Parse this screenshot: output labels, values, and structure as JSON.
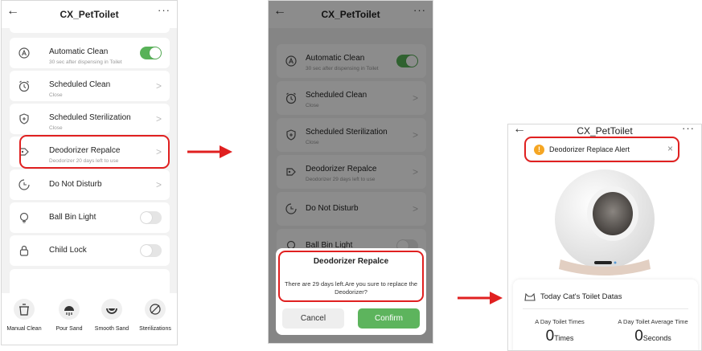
{
  "screen1": {
    "title": "CX_PetToilet",
    "back_glyph": "←",
    "more_glyph": "···",
    "settings": [
      {
        "title": "Automatic Clean",
        "subtitle": "30 sec after dispensing in Toilet",
        "control": "toggle",
        "enabled": true
      },
      {
        "title": "Scheduled Clean",
        "subtitle": "Close",
        "control": "chevron"
      },
      {
        "title": "Scheduled Sterilization",
        "subtitle": "Close",
        "control": "chevron"
      },
      {
        "title": "Deodorizer Repalce",
        "subtitle": "Deodorizer 20 days left to use",
        "control": "chevron"
      },
      {
        "title": "Do Not Disturb",
        "subtitle": "",
        "control": "chevron"
      },
      {
        "title": "Ball Bin Light",
        "subtitle": "",
        "control": "toggle",
        "enabled": false
      },
      {
        "title": "Child Lock",
        "subtitle": "",
        "control": "toggle",
        "enabled": false
      }
    ],
    "bottom_actions": [
      {
        "label": "Manual Clean",
        "icon": "trash-bin-icon"
      },
      {
        "label": "Pour Sand",
        "icon": "pour-sand-icon"
      },
      {
        "label": "Smooth Sand",
        "icon": "smooth-sand-icon"
      },
      {
        "label": "Sterilizations",
        "icon": "sterilize-icon"
      }
    ]
  },
  "screen2": {
    "title": "CX_PetToilet",
    "back_glyph": "←",
    "more_glyph": "···",
    "settings": [
      {
        "title": "Automatic Clean",
        "subtitle": "30 sec after dispensing in Toilet",
        "control": "toggle",
        "enabled": true
      },
      {
        "title": "Scheduled Clean",
        "subtitle": "Close",
        "control": "chevron"
      },
      {
        "title": "Scheduled Sterilization",
        "subtitle": "Close",
        "control": "chevron"
      },
      {
        "title": "Deodorizer Repalce",
        "subtitle": "Deodorizer 29 days left to use",
        "control": "chevron"
      },
      {
        "title": "Do Not Disturb",
        "subtitle": "",
        "control": "chevron"
      },
      {
        "title": "Ball Bin Light",
        "subtitle": "",
        "control": "toggle",
        "enabled": false
      }
    ],
    "dialog": {
      "title": "Deodorizer Repalce",
      "message": "There are 29 days left.Are you sure to replace the Deodorizer?",
      "cancel_label": "Cancel",
      "confirm_label": "Confirm"
    }
  },
  "screen3": {
    "title": "CX_PetToilet",
    "back_glyph": "←",
    "more_glyph": "···",
    "alert": {
      "icon_glyph": "!",
      "text": "Deodorizer Replace Alert",
      "close_glyph": "×"
    },
    "datas": {
      "heading": "Today Cat's Toilet Datas",
      "times_label": "A Day Toilet Times",
      "times_value": "0",
      "times_unit": "Times",
      "avg_label": "A Day Toilet Average Time",
      "avg_value": "0",
      "avg_unit": "Seconds"
    }
  },
  "colors": {
    "accent_green": "#5db45d",
    "highlight_red": "#e02020",
    "warning_orange": "#f5a623"
  }
}
